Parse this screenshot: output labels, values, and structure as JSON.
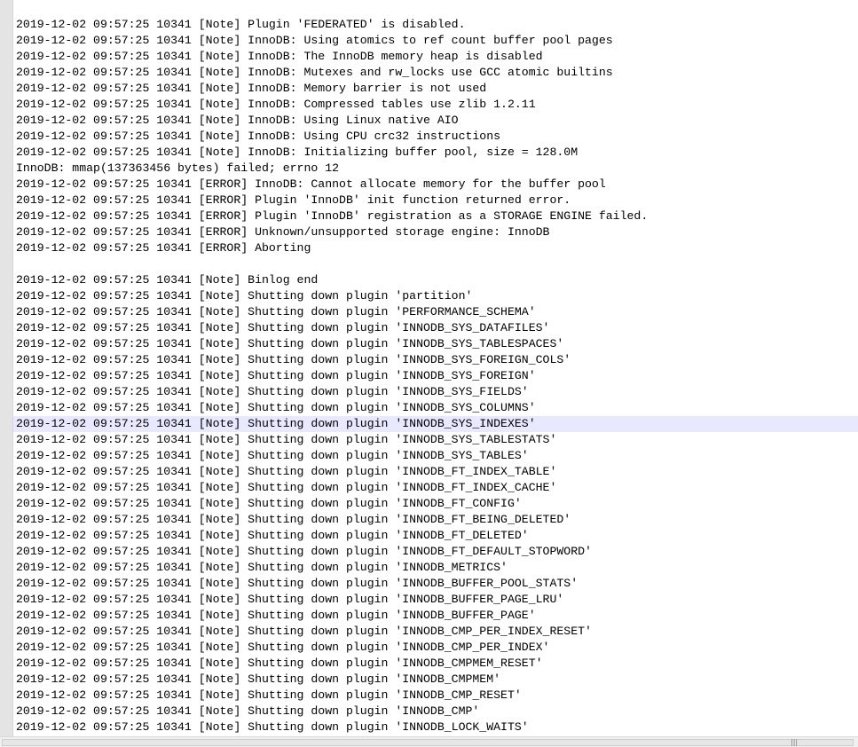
{
  "editor": {
    "current_line_index": 25,
    "lines": [
      "2019-12-02 09:57:25 10341 [Note] Plugin 'FEDERATED' is disabled.",
      "2019-12-02 09:57:25 10341 [Note] InnoDB: Using atomics to ref count buffer pool pages",
      "2019-12-02 09:57:25 10341 [Note] InnoDB: The InnoDB memory heap is disabled",
      "2019-12-02 09:57:25 10341 [Note] InnoDB: Mutexes and rw_locks use GCC atomic builtins",
      "2019-12-02 09:57:25 10341 [Note] InnoDB: Memory barrier is not used",
      "2019-12-02 09:57:25 10341 [Note] InnoDB: Compressed tables use zlib 1.2.11",
      "2019-12-02 09:57:25 10341 [Note] InnoDB: Using Linux native AIO",
      "2019-12-02 09:57:25 10341 [Note] InnoDB: Using CPU crc32 instructions",
      "2019-12-02 09:57:25 10341 [Note] InnoDB: Initializing buffer pool, size = 128.0M",
      "InnoDB: mmap(137363456 bytes) failed; errno 12",
      "2019-12-02 09:57:25 10341 [ERROR] InnoDB: Cannot allocate memory for the buffer pool",
      "2019-12-02 09:57:25 10341 [ERROR] Plugin 'InnoDB' init function returned error.",
      "2019-12-02 09:57:25 10341 [ERROR] Plugin 'InnoDB' registration as a STORAGE ENGINE failed.",
      "2019-12-02 09:57:25 10341 [ERROR] Unknown/unsupported storage engine: InnoDB",
      "2019-12-02 09:57:25 10341 [ERROR] Aborting",
      "",
      "2019-12-02 09:57:25 10341 [Note] Binlog end",
      "2019-12-02 09:57:25 10341 [Note] Shutting down plugin 'partition'",
      "2019-12-02 09:57:25 10341 [Note] Shutting down plugin 'PERFORMANCE_SCHEMA'",
      "2019-12-02 09:57:25 10341 [Note] Shutting down plugin 'INNODB_SYS_DATAFILES'",
      "2019-12-02 09:57:25 10341 [Note] Shutting down plugin 'INNODB_SYS_TABLESPACES'",
      "2019-12-02 09:57:25 10341 [Note] Shutting down plugin 'INNODB_SYS_FOREIGN_COLS'",
      "2019-12-02 09:57:25 10341 [Note] Shutting down plugin 'INNODB_SYS_FOREIGN'",
      "2019-12-02 09:57:25 10341 [Note] Shutting down plugin 'INNODB_SYS_FIELDS'",
      "2019-12-02 09:57:25 10341 [Note] Shutting down plugin 'INNODB_SYS_COLUMNS'",
      "2019-12-02 09:57:25 10341 [Note] Shutting down plugin 'INNODB_SYS_INDEXES'",
      "2019-12-02 09:57:25 10341 [Note] Shutting down plugin 'INNODB_SYS_TABLESTATS'",
      "2019-12-02 09:57:25 10341 [Note] Shutting down plugin 'INNODB_SYS_TABLES'",
      "2019-12-02 09:57:25 10341 [Note] Shutting down plugin 'INNODB_FT_INDEX_TABLE'",
      "2019-12-02 09:57:25 10341 [Note] Shutting down plugin 'INNODB_FT_INDEX_CACHE'",
      "2019-12-02 09:57:25 10341 [Note] Shutting down plugin 'INNODB_FT_CONFIG'",
      "2019-12-02 09:57:25 10341 [Note] Shutting down plugin 'INNODB_FT_BEING_DELETED'",
      "2019-12-02 09:57:25 10341 [Note] Shutting down plugin 'INNODB_FT_DELETED'",
      "2019-12-02 09:57:25 10341 [Note] Shutting down plugin 'INNODB_FT_DEFAULT_STOPWORD'",
      "2019-12-02 09:57:25 10341 [Note] Shutting down plugin 'INNODB_METRICS'",
      "2019-12-02 09:57:25 10341 [Note] Shutting down plugin 'INNODB_BUFFER_POOL_STATS'",
      "2019-12-02 09:57:25 10341 [Note] Shutting down plugin 'INNODB_BUFFER_PAGE_LRU'",
      "2019-12-02 09:57:25 10341 [Note] Shutting down plugin 'INNODB_BUFFER_PAGE'",
      "2019-12-02 09:57:25 10341 [Note] Shutting down plugin 'INNODB_CMP_PER_INDEX_RESET'",
      "2019-12-02 09:57:25 10341 [Note] Shutting down plugin 'INNODB_CMP_PER_INDEX'",
      "2019-12-02 09:57:25 10341 [Note] Shutting down plugin 'INNODB_CMPMEM_RESET'",
      "2019-12-02 09:57:25 10341 [Note] Shutting down plugin 'INNODB_CMPMEM'",
      "2019-12-02 09:57:25 10341 [Note] Shutting down plugin 'INNODB_CMP_RESET'",
      "2019-12-02 09:57:25 10341 [Note] Shutting down plugin 'INNODB_CMP'",
      "2019-12-02 09:57:25 10341 [Note] Shutting down plugin 'INNODB_LOCK_WAITS'"
    ]
  },
  "scrollbar": {
    "grip_glyph": "|||"
  },
  "colors": {
    "text": "#000000",
    "current_line": "#e8e8ff",
    "gutter": "#e4e4e4",
    "background": "#ffffff"
  }
}
